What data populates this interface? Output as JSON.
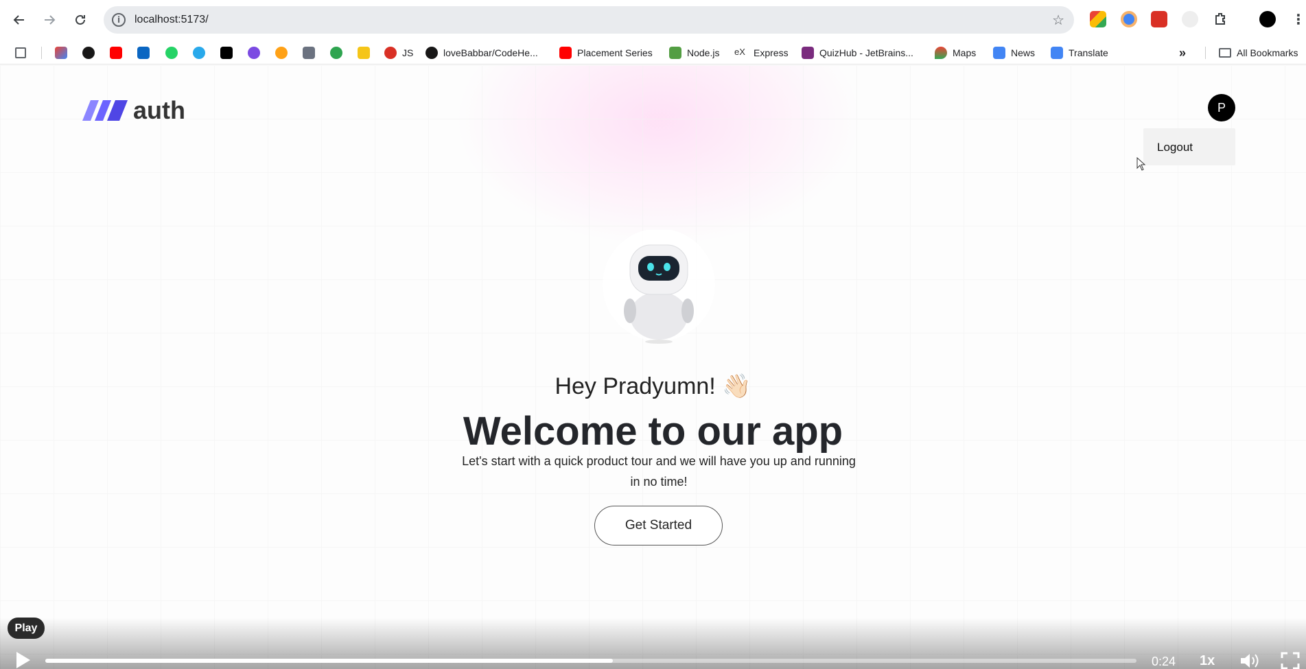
{
  "browser": {
    "url": "localhost:5173/",
    "bookmarks": [
      {
        "label": "",
        "icon": "apps-icon"
      },
      {
        "label": "",
        "icon": "gmail-icon"
      },
      {
        "label": "",
        "icon": "github-icon"
      },
      {
        "label": "",
        "icon": "youtube-icon"
      },
      {
        "label": "",
        "icon": "linkedin-icon"
      },
      {
        "label": "",
        "icon": "whatsapp-icon"
      },
      {
        "label": "",
        "icon": "telegram-icon"
      },
      {
        "label": "",
        "icon": "nextjs-icon"
      },
      {
        "label": "",
        "icon": "badge-icon"
      },
      {
        "label": "",
        "icon": "leetcode-icon"
      },
      {
        "label": "",
        "icon": "tool-icon"
      },
      {
        "label": "",
        "icon": "codechef-icon"
      },
      {
        "label": "",
        "icon": "json-icon"
      },
      {
        "label": "JS",
        "icon": "js-icon"
      },
      {
        "label": "loveBabbar/CodeHe...",
        "icon": "github-icon"
      },
      {
        "label": "Placement Series",
        "icon": "youtube-icon"
      },
      {
        "label": "Node.js",
        "icon": "nodejs-icon"
      },
      {
        "label": "Express",
        "icon": "express-icon"
      },
      {
        "label": "QuizHub - JetBrains...",
        "icon": "quizhub-icon"
      },
      {
        "label": "Maps",
        "icon": "maps-icon"
      },
      {
        "label": "News",
        "icon": "news-icon"
      },
      {
        "label": "Translate",
        "icon": "translate-icon"
      }
    ],
    "all_bookmarks": "All Bookmarks"
  },
  "app": {
    "logo_text": "auth",
    "avatar_initial": "P",
    "menu": {
      "logout": "Logout"
    },
    "greeting": "Hey Pradyumn! 👋🏻",
    "title": "Welcome to our app",
    "description": "Let's start with a quick product tour and we will have you up and running in no time!",
    "cta": "Get Started"
  },
  "video": {
    "play_tooltip": "Play",
    "time": "0:24",
    "speed": "1x",
    "progress": 0.52
  },
  "colors": {
    "logo_accent": "#6c63ff",
    "page_glow": "#ffdcf5"
  }
}
